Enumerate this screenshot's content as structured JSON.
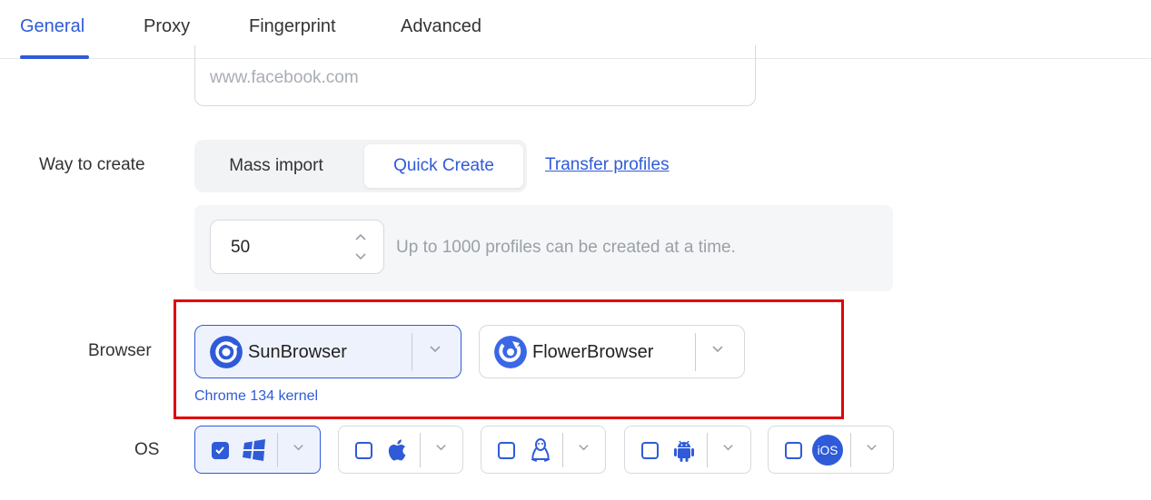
{
  "tabs": [
    {
      "label": "General",
      "active": true
    },
    {
      "label": "Proxy",
      "active": false
    },
    {
      "label": "Fingerprint",
      "active": false
    },
    {
      "label": "Advanced",
      "active": false
    }
  ],
  "url_field": {
    "placeholder": "www.facebook.com"
  },
  "way_to_create": {
    "label": "Way to create",
    "options": [
      "Mass import",
      "Quick Create"
    ],
    "selected": "Quick Create",
    "link": "Transfer profiles"
  },
  "quantity": {
    "value": "50",
    "hint": "Up to 1000 profiles can be created at a time."
  },
  "browser": {
    "label": "Browser",
    "options": [
      {
        "name": "SunBrowser",
        "selected": true
      },
      {
        "name": "FlowerBrowser",
        "selected": false
      }
    ],
    "kernel_note": "Chrome 134 kernel"
  },
  "os": {
    "label": "OS",
    "options": [
      {
        "icon": "windows-icon",
        "checked": true
      },
      {
        "icon": "apple-icon",
        "checked": false
      },
      {
        "icon": "linux-icon",
        "checked": false
      },
      {
        "icon": "android-icon",
        "checked": false
      },
      {
        "icon": "ios-icon",
        "checked": false,
        "text": "iOS"
      }
    ]
  },
  "colors": {
    "accent": "#2f5bd8",
    "highlight": "#e00000"
  }
}
